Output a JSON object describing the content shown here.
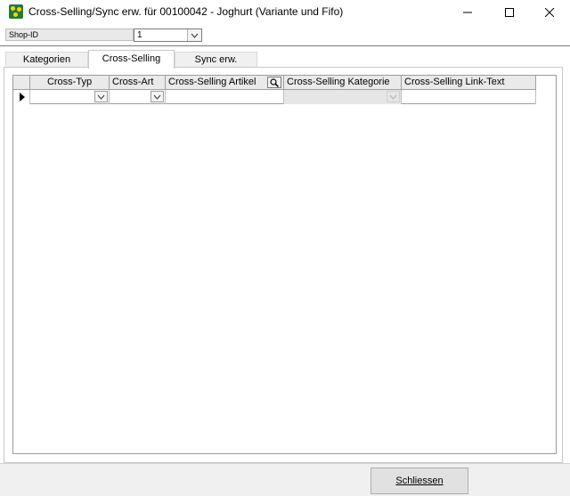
{
  "window": {
    "title": "Cross-Selling/Sync erw. für 00100042 - Joghurt (Variante und Fifo)",
    "minimize": "—",
    "maximize": "☐",
    "close": "✕"
  },
  "shop": {
    "label": "Shop-ID",
    "value": "1"
  },
  "tabs": [
    "Kategorien",
    "Cross-Selling",
    "Sync erw."
  ],
  "active_tab": "Cross-Selling",
  "grid": {
    "columns": [
      "Cross-Typ",
      "Cross-Art",
      "Cross-Selling Artikel",
      "Cross-Selling Kategorie",
      "Cross-Selling Link-Text"
    ],
    "rows": [
      {
        "cross_typ": "",
        "cross_art": "",
        "artikel": "",
        "kategorie": "",
        "link_text": ""
      }
    ]
  },
  "footer": {
    "close_button": "Schliessen"
  },
  "colors": {
    "app_icon": "#1f7a3c",
    "header_bg": "#eaeaea",
    "dialog_bg": "#f0f0f0"
  }
}
